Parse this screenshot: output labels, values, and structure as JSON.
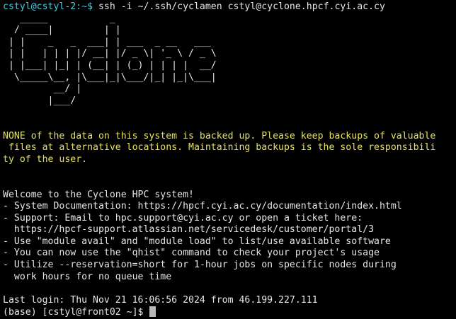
{
  "session": {
    "local_prompt_host": "cstyl@cstyl-2:~$",
    "ssh_command": " ssh -i ~/.ssh/cyclamen cstyl@cyclone.hpcf.cyi.ac.cy"
  },
  "banner": {
    "ascii_art": [
      "   _____           _",
      "  / ____|         | |",
      " | |    _   _  ___| | ___  _ __   ___",
      " | |   | | | |/ __| |/ _ \\| '_ \\ / _ \\",
      " | |___| |_| | (__| | (_) | | | |  __/",
      "  \\_____\\__, |\\___|_|\\___/|_| |_|\\___|",
      "         __/ |",
      "        |___/"
    ]
  },
  "notice": {
    "lines": [
      "NONE of the data on this system is backed up. Please keep backups of valuable",
      " files at alternative locations. Maintaining backups is the sole responsibili",
      "ty of the user."
    ]
  },
  "welcome": {
    "lines": [
      "Welcome to the Cyclone HPC system!",
      "- System Documentation: https://hpcf.cyi.ac.cy/documentation/index.html",
      "- Support: Email to hpc.support@cyi.ac.cy or open a ticket here:",
      "  https://hpcf-support.atlassian.net/servicedesk/customer/portal/3",
      "- Use \"module avail\" and \"module load\" to list/use available software",
      "- You can now use the \"qhist\" command to check your project's usage",
      "- Utilize --reservation=short for 1-hour jobs on specific nodes during",
      "  work hours for no queue time"
    ]
  },
  "last_login": "Last login: Thu Nov 21 16:06:56 2024 from 46.199.227.111",
  "remote_prompt": "(base) [cstyl@front02 ~]$ ",
  "colors": {
    "background": "#000000",
    "foreground": "#e6e6e6",
    "prompt_host": "#3fd0e6",
    "notice": "#e8e25a",
    "cursor": "#b8b8b8"
  }
}
